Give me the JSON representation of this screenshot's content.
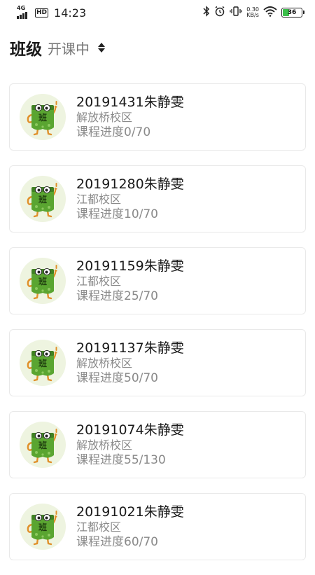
{
  "status_bar": {
    "network": "4G",
    "hd": "HD",
    "time": "14:23",
    "speed_value": "0.30",
    "speed_unit": "KB/s",
    "battery_level": "36",
    "battery_fraction": 0.36
  },
  "header": {
    "title": "班级",
    "filter_label": "开课中"
  },
  "avatar_text": "班",
  "colors": {
    "avatar_bg": "#eef4e0",
    "mascot_green": "#5aa531",
    "mascot_dark": "#3f8122",
    "mascot_orange": "#e0902a",
    "battery_green": "#3bbf4a"
  },
  "classes": [
    {
      "name": "20191431朱静雯",
      "campus": "解放桥校区",
      "progress": "课程进度0/70"
    },
    {
      "name": "20191280朱静雯",
      "campus": "江都校区",
      "progress": "课程进度10/70"
    },
    {
      "name": "20191159朱静雯",
      "campus": "江都校区",
      "progress": "课程进度25/70"
    },
    {
      "name": "20191137朱静雯",
      "campus": "解放桥校区",
      "progress": "课程进度50/70"
    },
    {
      "name": "20191074朱静雯",
      "campus": "解放桥校区",
      "progress": "课程进度55/130"
    },
    {
      "name": "20191021朱静雯",
      "campus": "江都校区",
      "progress": "课程进度60/70"
    }
  ]
}
